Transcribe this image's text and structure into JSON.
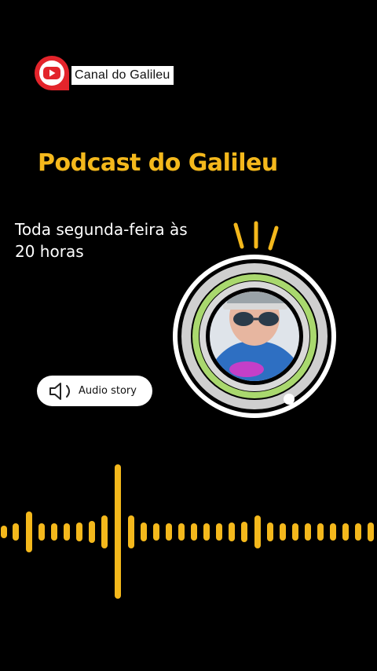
{
  "header": {
    "channel_name": "Canal do Galileu",
    "logo_icon": "play-bubble-icon"
  },
  "main": {
    "title": "Podcast do Galileu",
    "schedule_line1": "Toda segunda-feira às",
    "schedule_line2": "20 horas"
  },
  "audio_button": {
    "label": "Audio story",
    "icon": "speaker-icon"
  },
  "colors": {
    "accent": "#f4b81c",
    "background": "#000000",
    "ring_green": "#a9d86e",
    "logo_red": "#e3242b"
  }
}
